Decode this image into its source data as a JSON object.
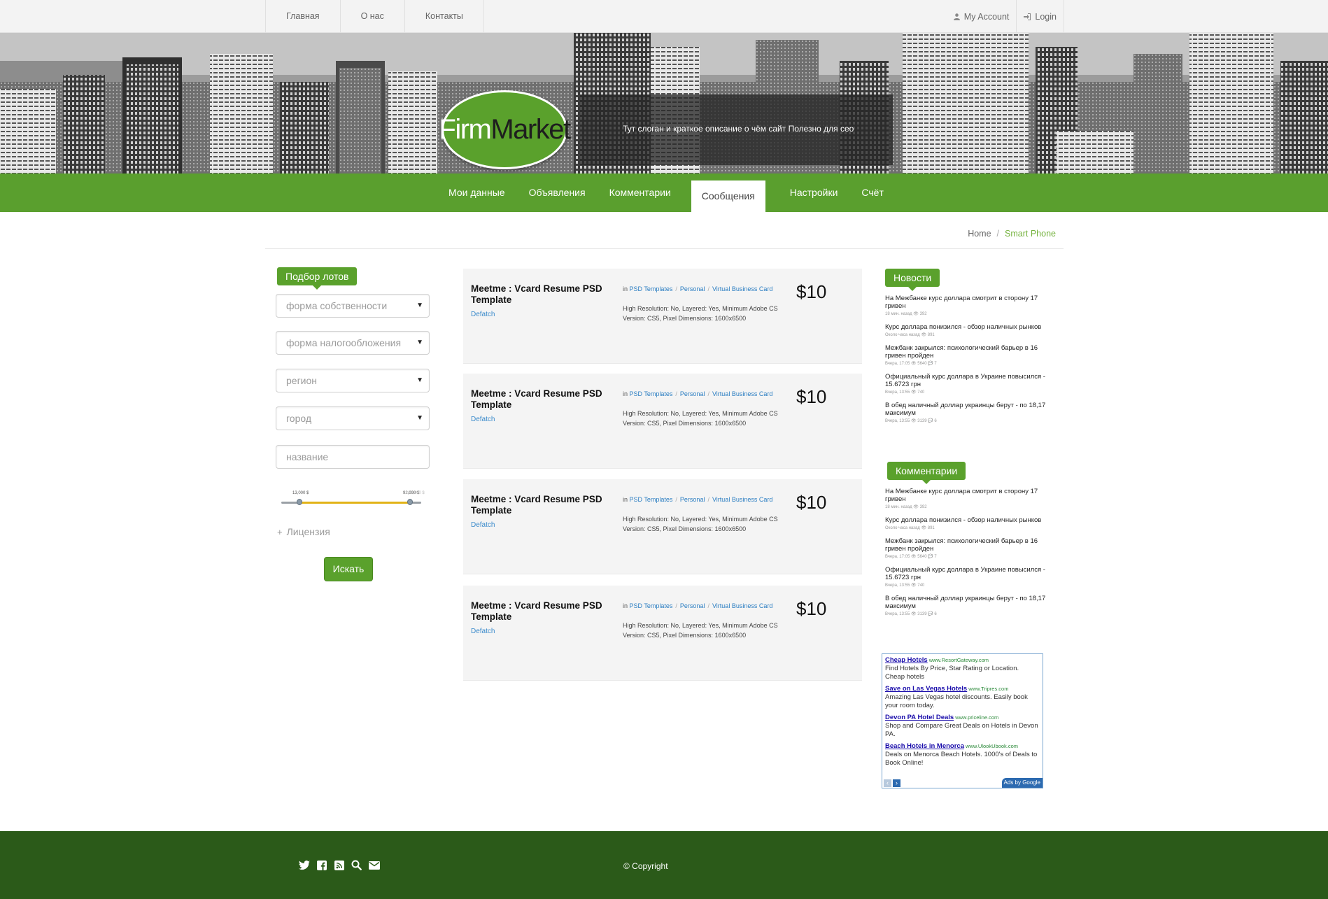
{
  "topbar": {
    "nav": [
      "Главная",
      "О нас",
      "Контакты"
    ],
    "account": "My Account",
    "login": "Login"
  },
  "header": {
    "logo_firm": "Firm",
    "logo_market": "Market",
    "slogan": "Тут слоган и краткое описание о чём сайт  Полезно для сео"
  },
  "mainnav": [
    "Мои данные",
    "Объявления",
    "Комментарии",
    "Сообщения",
    "Настройки",
    "Счёт"
  ],
  "mainnav_active": "Сообщения",
  "breadcrumb": {
    "home": "Home",
    "separator": "/",
    "current": "Smart Phone"
  },
  "filter": {
    "heading": "Подбор лотов",
    "selects": [
      "форма собственности",
      "форма налогообложения",
      "регион",
      "город"
    ],
    "name_placeholder": "название",
    "slider": {
      "min_label": "13,000 $",
      "max_label": "92,000 $",
      "end_label": "100,000 $",
      "min_value": 13000,
      "max_value": 92000,
      "range_max": 100000
    },
    "license": "Лицензия",
    "search_button": "Искать"
  },
  "listings": [
    {
      "title": "Meetme : Vcard Resume PSD Template",
      "author": "Defatch",
      "in": "in",
      "cats": [
        "PSD Templates",
        "Personal",
        "Virtual Business Card"
      ],
      "desc": "High Resolution: No, Layered: Yes, Minimum Adobe CS Version: CS5, Pixel Dimensions: 1600x6500",
      "price": "$10"
    },
    {
      "title": "Meetme : Vcard Resume PSD Template",
      "author": "Defatch",
      "in": "in",
      "cats": [
        "PSD Templates",
        "Personal",
        "Virtual Business Card"
      ],
      "desc": "High Resolution: No, Layered: Yes, Minimum Adobe CS Version: CS5, Pixel Dimensions: 1600x6500",
      "price": "$10"
    },
    {
      "title": "Meetme : Vcard Resume PSD Template",
      "author": "Defatch",
      "in": "in",
      "cats": [
        "PSD Templates",
        "Personal",
        "Virtual Business Card"
      ],
      "desc": "High Resolution: No, Layered: Yes, Minimum Adobe CS Version: CS5, Pixel Dimensions: 1600x6500",
      "price": "$10"
    },
    {
      "title": "Meetme : Vcard Resume PSD Template",
      "author": "Defatch",
      "in": "in",
      "cats": [
        "PSD Templates",
        "Personal",
        "Virtual Business Card"
      ],
      "desc": "High Resolution: No, Layered: Yes, Minimum Adobe CS Version: CS5, Pixel Dimensions: 1600x6500",
      "price": "$10"
    }
  ],
  "news": {
    "heading": "Новости",
    "items": [
      {
        "title": "На Межбанке курс доллара смотрит в сторону 17 гривен",
        "meta": "18 мин. назад  👁 392"
      },
      {
        "title": "Курс доллара понизился - обзор наличных рынков",
        "meta": "Около часа назад  👁 891"
      },
      {
        "title": "Межбанк закрылся: психологический барьер в 16 гривен пройден",
        "meta": "Вчера, 17:05  👁 5640  💬 7"
      },
      {
        "title": "Официальный курс доллара в Украине повысился - 15.6723 грн",
        "meta": "Вчера, 13:55  👁 740"
      },
      {
        "title": "В обед наличный доллар украинцы берут - по 18,17 максимум",
        "meta": "Вчера, 13:55  👁 3139  💬 6"
      }
    ]
  },
  "comments": {
    "heading": "Комментарии",
    "items": [
      {
        "title": "На Межбанке курс доллара смотрит в сторону 17 гривен",
        "meta": "18 мин. назад  👁 392"
      },
      {
        "title": "Курс доллара понизился - обзор наличных рынков",
        "meta": "Около часа назад  👁 891"
      },
      {
        "title": "Межбанк закрылся: психологический барьер в 16 гривен пройден",
        "meta": "Вчера, 17:05  👁 5640  💬 7"
      },
      {
        "title": "Официальный курс доллара в Украине повысился - 15.6723 грн",
        "meta": "Вчера, 13:55  👁 740"
      },
      {
        "title": "В обед наличный доллар украинцы берут - по 18,17 максимум",
        "meta": "Вчера, 13:55  👁 3139  💬 6"
      }
    ]
  },
  "ads": {
    "items": [
      {
        "title": "Cheap Hotels",
        "url": "www.ResortGateway.com",
        "text": "Find Hotels By Price, Star Rating or Location. Cheap hotels"
      },
      {
        "title": "Save on Las Vegas Hotels",
        "url": "www.Tripres.com",
        "text": "Amazing Las Vegas hotel discounts. Easily book your room today."
      },
      {
        "title": "Devon PA Hotel Deals",
        "url": "www.priceline.com",
        "text": "Shop and Compare Great Deals on Hotels in Devon PA."
      },
      {
        "title": "Beach Hotels in Menorca",
        "url": "www.UlookUbook.com",
        "text": "Deals on Menorca Beach Hotels. 1000's of Deals to Book Online!"
      }
    ],
    "by_google": "Ads by Google"
  },
  "footer": {
    "copyright": "© Copyright"
  }
}
